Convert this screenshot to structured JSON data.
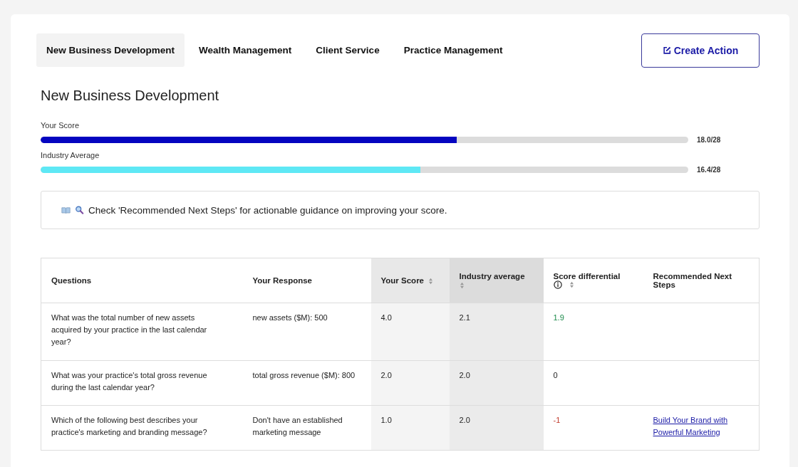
{
  "tabs": [
    {
      "label": "New Business Development",
      "selected": true
    },
    {
      "label": "Wealth Management",
      "selected": false
    },
    {
      "label": "Client Service",
      "selected": false
    },
    {
      "label": "Practice Management",
      "selected": false
    }
  ],
  "create_button": {
    "label": "Create Action"
  },
  "heading": "New Business Development",
  "meters": [
    {
      "label": "Your Score",
      "level": 0.643,
      "reading": "18.0/28",
      "kind": "score"
    },
    {
      "label": "Industry Average",
      "level": 0.586,
      "reading": "16.4/28",
      "kind": "industry"
    }
  ],
  "tip": "Check 'Recommended Next Steps' for actionable guidance on improving your score.",
  "table": {
    "columns": [
      {
        "label": "Questions",
        "sortable": false,
        "info": false
      },
      {
        "label": "Your Response",
        "sortable": false,
        "info": false
      },
      {
        "label": "Your Score",
        "sortable": true,
        "info": false
      },
      {
        "label": "Industry average",
        "sortable": true,
        "info": false
      },
      {
        "label": "Score differential",
        "sortable": true,
        "info": true
      },
      {
        "label": "Recommended Next Steps",
        "sortable": false,
        "info": false
      }
    ],
    "rows": [
      {
        "question": "What was the total number of new assets acquired by your practice in the last calendar year?",
        "response": "new assets ($M): 500",
        "score": "4.0",
        "industry": "2.1",
        "differential": "1.9",
        "kind": "gain"
      },
      {
        "question": "What was your practice's total gross revenue during the last calendar year?",
        "response": "total gross revenue ($M): 800",
        "score": "2.0",
        "industry": "2.0",
        "differential": "0",
        "kind": "even"
      },
      {
        "question": "Which of the following best describes your practice's marketing and branding message?",
        "response": "Don't have an established marketing message",
        "score": "1.0",
        "industry": "2.0",
        "differential": "-1",
        "kind": "loss",
        "next_step": "Build Your Brand with Powerful Marketing"
      }
    ]
  }
}
